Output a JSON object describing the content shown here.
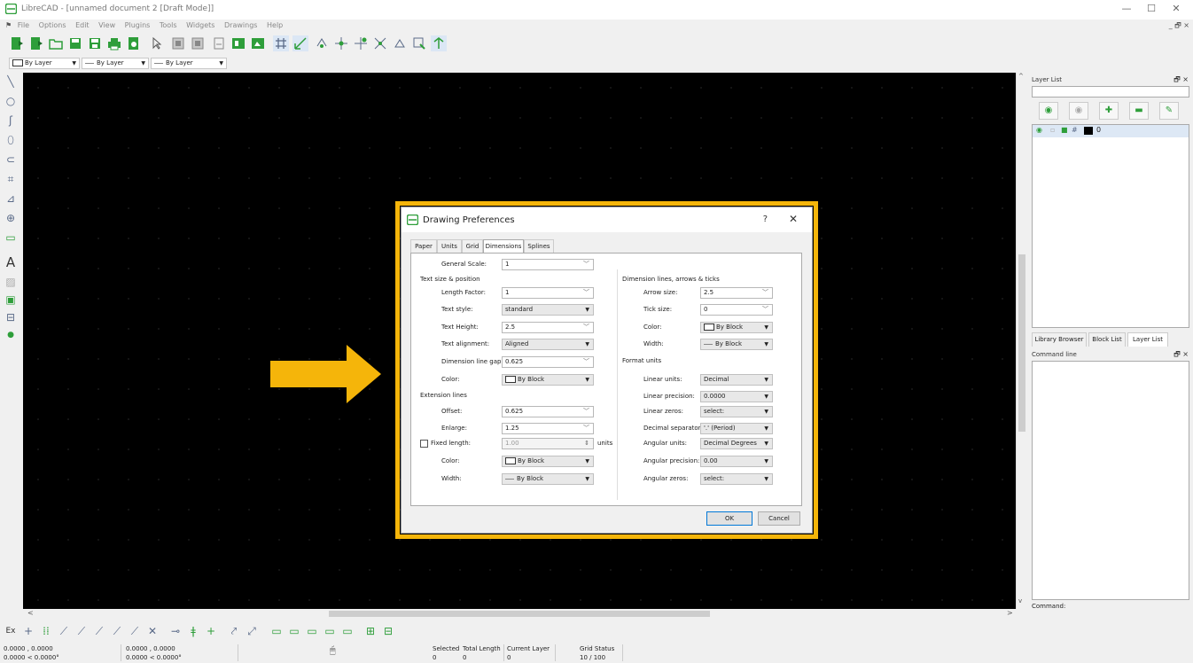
{
  "window": {
    "title": "LibreCAD - [unnamed document 2 [Draft Mode]]",
    "minimize": "—",
    "maximize": "☐",
    "close": "✕",
    "mdi_controls": "_ 🗗 ×"
  },
  "menubar": [
    "File",
    "Options",
    "Edit",
    "View",
    "Plugins",
    "Tools",
    "Widgets",
    "Drawings",
    "Help"
  ],
  "toolbar2": {
    "color": "By Layer",
    "linetype": "By Layer",
    "linewidth": "By Layer"
  },
  "dialog": {
    "title": "Drawing Preferences",
    "help": "?",
    "close": "✕",
    "tabs": [
      "Paper",
      "Units",
      "Grid",
      "Dimensions",
      "Splines"
    ],
    "active_tab": "Dimensions",
    "general_scale_label": "General Scale:",
    "general_scale": "1",
    "text_section": "Text size & position",
    "length_factor_label": "Length Factor:",
    "length_factor": "1",
    "text_style_label": "Text style:",
    "text_style": "standard",
    "text_height_label": "Text Height:",
    "text_height": "2.5",
    "text_alignment_label": "Text alignment:",
    "text_alignment": "Aligned",
    "dim_line_gap_label": "Dimension line gap:",
    "dim_line_gap": "0.625",
    "text_color_label": "Color:",
    "text_color": "By Block",
    "ext_section": "Extension lines",
    "offset_label": "Offset:",
    "offset": "0.625",
    "enlarge_label": "Enlarge:",
    "enlarge": "1.25",
    "fixed_length_label": "Fixed length:",
    "fixed_length": "1.00",
    "fixed_length_units": "units",
    "ext_color_label": "Color:",
    "ext_color": "By Block",
    "ext_width_label": "Width:",
    "ext_width": "By Block",
    "dim_section": "Dimension lines, arrows & ticks",
    "arrow_size_label": "Arrow size:",
    "arrow_size": "2.5",
    "tick_size_label": "Tick size:",
    "tick_size": "0",
    "dim_color_label": "Color:",
    "dim_color": "By Block",
    "dim_width_label": "Width:",
    "dim_width": "By Block",
    "format_section": "Format units",
    "linear_units_label": "Linear units:",
    "linear_units": "Decimal",
    "linear_precision_label": "Linear precision:",
    "linear_precision": "0.0000",
    "linear_zeros_label": "Linear zeros:",
    "linear_zeros": "select:",
    "decimal_sep_label": "Decimal separator:",
    "decimal_sep": "'.' (Period)",
    "angular_units_label": "Angular units:",
    "angular_units": "Decimal Degrees",
    "angular_precision_label": "Angular precision:",
    "angular_precision": "0.00",
    "angular_zeros_label": "Angular zeros:",
    "angular_zeros": "select:",
    "ok": "OK",
    "cancel": "Cancel"
  },
  "layer_panel": {
    "title": "Layer List",
    "layer_name": "0"
  },
  "dock_tabs": [
    "Library Browser",
    "Block List",
    "Layer List"
  ],
  "command_panel": {
    "title": "Command line",
    "input_label": "Command:"
  },
  "bottom_toolbar_label": "Ex",
  "status": {
    "coord_abs_1": "0.0000 , 0.0000",
    "coord_abs_2": "0.0000 < 0.0000°",
    "coord_rel_1": "0.0000 , 0.0000",
    "coord_rel_2": "0.0000 < 0.0000°",
    "selected_label": "Selected",
    "selected_value": "0",
    "total_length_label": "Total Length",
    "total_length_value": "0",
    "current_layer_label": "Current Layer",
    "current_layer_value": "0",
    "grid_status_label": "Grid Status",
    "grid_status_value": "10 / 100"
  },
  "colors": {
    "highlight": "#f5b50a",
    "canvas": "#000000",
    "icon_green": "#2e9e3a"
  }
}
